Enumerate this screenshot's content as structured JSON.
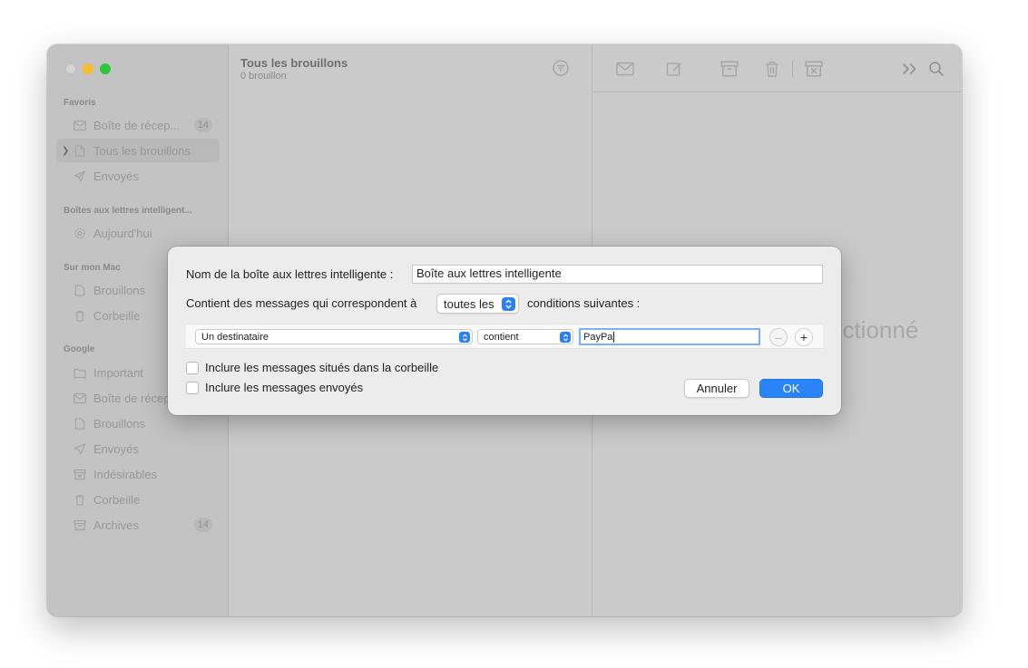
{
  "sidebar": {
    "favorites_header": "Favoris",
    "favorites": [
      {
        "label": "Boîte de récep...",
        "icon": "envelope-icon",
        "badge": "14"
      },
      {
        "label": "Tous les brouillons",
        "icon": "document-icon",
        "badge": ""
      },
      {
        "label": "Envoyés",
        "icon": "paperplane-icon",
        "badge": ""
      }
    ],
    "smart_header": "Boîtes aux lettres intelligent...",
    "smart": [
      {
        "label": "Aujourd'hui",
        "icon": "gear-icon"
      }
    ],
    "mac_header": "Sur mon Mac",
    "mac": [
      {
        "label": "Brouillons",
        "icon": "document-icon"
      },
      {
        "label": "Corbeille",
        "icon": "trash-icon"
      }
    ],
    "google_header": "Google",
    "google": [
      {
        "label": "Important",
        "icon": "folder-icon",
        "badge": ""
      },
      {
        "label": "Boîte de récep",
        "icon": "envelope-icon",
        "badge": ""
      },
      {
        "label": "Brouillons",
        "icon": "document-icon",
        "badge": ""
      },
      {
        "label": "Envoyés",
        "icon": "paperplane-icon",
        "badge": ""
      },
      {
        "label": "Indésirables",
        "icon": "junk-icon",
        "badge": ""
      },
      {
        "label": "Corbeille",
        "icon": "trash-icon",
        "badge": ""
      },
      {
        "label": "Archives",
        "icon": "archive-icon",
        "badge": "14"
      }
    ]
  },
  "message_list": {
    "title": "Tous les brouillons",
    "subtitle": "0 brouillon"
  },
  "viewer": {
    "no_selection_text": "ectionné"
  },
  "dialog": {
    "name_label": "Nom de la boîte aux lettres intelligente :",
    "name_value": "Boîte aux lettres intelligente",
    "condition_prefix": "Contient des messages qui correspondent à",
    "condition_mode": "toutes les",
    "condition_suffix": "conditions suivantes :",
    "criterion": {
      "field": "Un destinataire",
      "operator": "contient",
      "value": "PayPa"
    },
    "remove_symbol": "–",
    "add_symbol": "+",
    "include_trash": "Inclure les messages situés dans la corbeille",
    "include_sent": "Inclure les messages envoyés",
    "cancel_label": "Annuler",
    "ok_label": "OK"
  },
  "colors": {
    "accent": "#2a84f7",
    "dimmed_text": "#979797"
  }
}
